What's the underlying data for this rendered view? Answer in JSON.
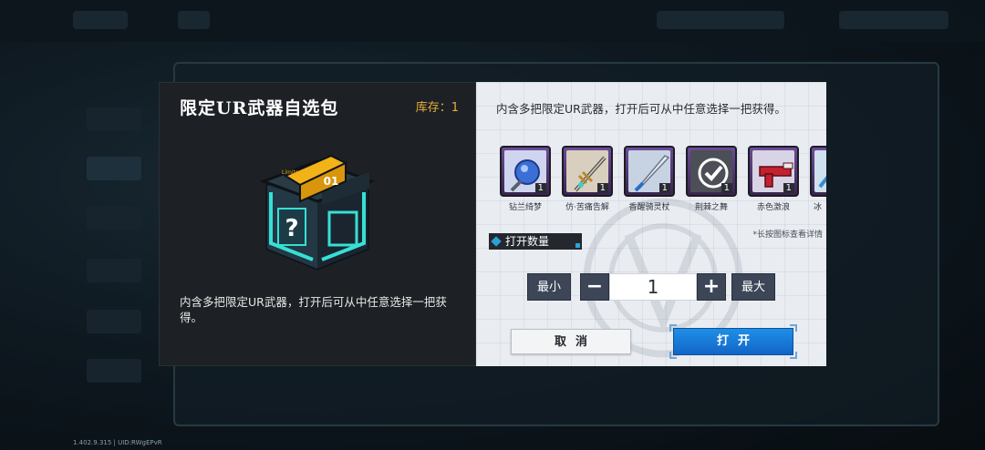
{
  "background": {
    "version_text": "1.402.9.315 | UID:RWgEPvR"
  },
  "dialog": {
    "title": "限定UR武器自选包",
    "stock_label": "库存：",
    "stock_value": "1",
    "left_description": "内含多把限定UR武器，打开后可从中任意选择一把获得。",
    "right_description": "内含多把限定UR武器，打开后可从中任意选择一把获得。",
    "box_badge": "01",
    "box_tag": "Limited",
    "items": [
      {
        "name": "钻兰绮梦",
        "count": "1",
        "icon": "blue-gem-staff-icon"
      },
      {
        "name": "仿·苦痛告解",
        "count": "1",
        "icon": "ornate-sword-icon"
      },
      {
        "name": "香醒骑灵杖",
        "count": "1",
        "icon": "silver-blade-icon"
      },
      {
        "name": "荆棘之舞",
        "count": "1",
        "icon": "selected-check-icon"
      },
      {
        "name": "赤色激浪",
        "count": "1",
        "icon": "red-gun-icon"
      },
      {
        "name": "冰",
        "count": "",
        "icon": "partial-weapon-icon"
      }
    ],
    "hint": "*长按图标查看详情",
    "open_quantity_label": "打开数量",
    "min_label": "最小",
    "max_label": "最大",
    "minus_symbol": "−",
    "plus_symbol": "+",
    "quantity_value": "1",
    "cancel_label": "取消",
    "open_label": "打开"
  }
}
